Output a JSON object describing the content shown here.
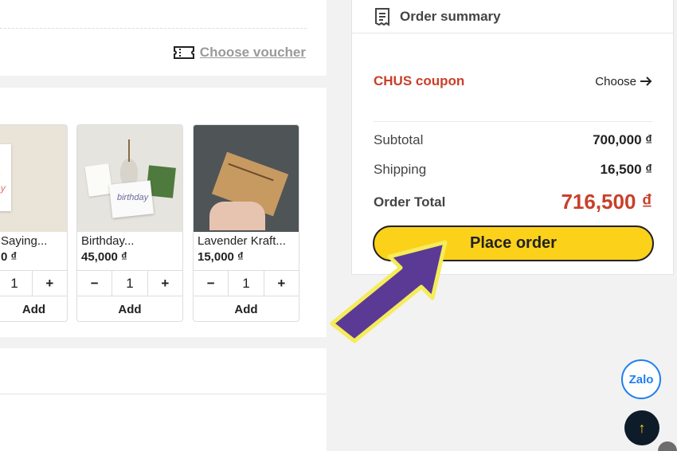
{
  "voucher": {
    "label": "Choose voucher",
    "icon": "ticket-icon"
  },
  "products": [
    {
      "name": "Saying...",
      "price": "0 ₫",
      "qty": "1",
      "minus": "−",
      "plus": "+",
      "add": "Add"
    },
    {
      "name": "Birthday...",
      "price": "45,000 ₫",
      "qty": "1",
      "minus": "−",
      "plus": "+",
      "add": "Add"
    },
    {
      "name": "Lavender Kraft...",
      "price": "15,000 ₫",
      "qty": "1",
      "minus": "−",
      "plus": "+",
      "add": "Add"
    }
  ],
  "summary": {
    "title": "Order summary",
    "icon": "receipt-icon",
    "coupon_label": "CHUS coupon",
    "coupon_action": "Choose",
    "subtotal_label": "Subtotal",
    "subtotal_value": "700,000 ₫",
    "shipping_label": "Shipping",
    "shipping_value": "16,500 ₫",
    "total_label": "Order Total",
    "total_value": "716,500 ₫",
    "place_order": "Place order"
  },
  "floating": {
    "zalo": "Zalo",
    "scroll_top": "↑"
  },
  "colors": {
    "accent": "#fcd11a",
    "price_red": "#c8402a",
    "arrow_purple": "#5b3a96",
    "zalo_blue": "#1f7ef0"
  }
}
